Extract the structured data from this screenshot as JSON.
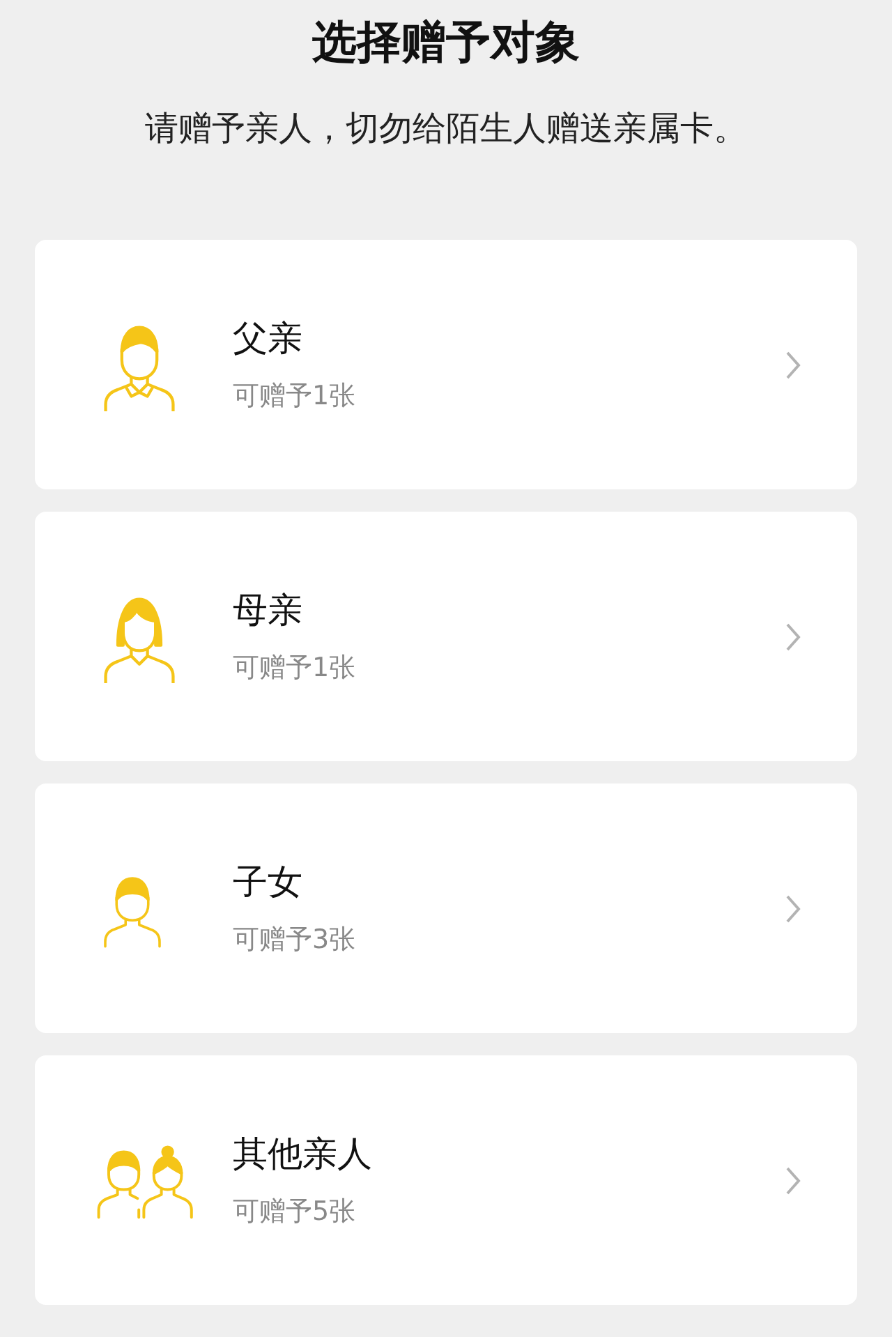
{
  "title": "选择赠予对象",
  "subtitle": "请赠予亲人，切勿给陌生人赠送亲属卡。",
  "recipients": [
    {
      "kind": "father",
      "name": "父亲",
      "quota": "可赠予1张"
    },
    {
      "kind": "mother",
      "name": "母亲",
      "quota": "可赠予1张"
    },
    {
      "kind": "child",
      "name": "子女",
      "quota": "可赠予3张"
    },
    {
      "kind": "others",
      "name": "其他亲人",
      "quota": "可赠予5张"
    }
  ]
}
